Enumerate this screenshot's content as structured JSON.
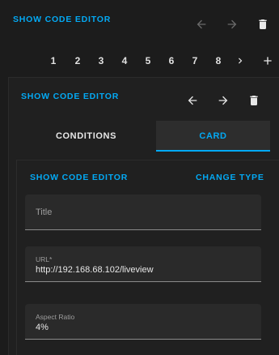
{
  "top": {
    "show_code_editor": "SHOW CODE EDITOR"
  },
  "pagination": {
    "pages": [
      "1",
      "2",
      "3",
      "4",
      "5",
      "6",
      "7",
      "8"
    ],
    "next": "›",
    "add": "+"
  },
  "card": {
    "show_code_editor": "SHOW CODE EDITOR",
    "tabs": [
      {
        "label": "CONDITIONS"
      },
      {
        "label": "CARD"
      }
    ],
    "editor": {
      "show_code_editor": "SHOW CODE EDITOR",
      "change_type": "CHANGE TYPE",
      "title_placeholder": "Title",
      "url_label": "URL*",
      "url_value": "http://192.168.68.102/liveview",
      "aspect_label": "Aspect Ratio",
      "aspect_value": "4%"
    }
  },
  "colors": {
    "accent": "#03a9f4",
    "background": "#1c1c1c",
    "field_bg": "#2a2a2a"
  },
  "icons": [
    "arrow-left-icon",
    "arrow-right-icon",
    "delete-icon",
    "chevron-right-icon",
    "plus-icon"
  ]
}
